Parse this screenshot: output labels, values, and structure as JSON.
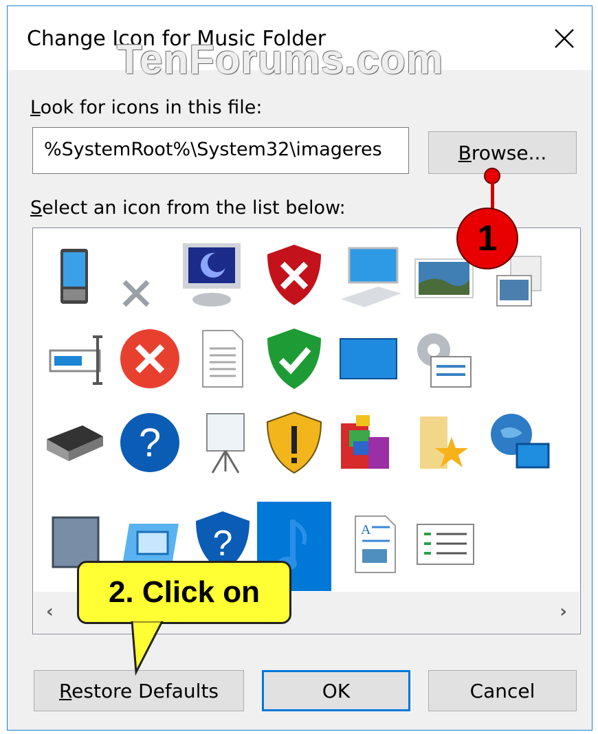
{
  "window": {
    "title": "Change Icon for Music Folder",
    "close_icon": "close-icon"
  },
  "watermark": "TenForums.com",
  "file_section": {
    "label_prefix": "L",
    "label_rest": "ook for icons in this file:",
    "path_value": "%SystemRoot%\\System32\\imageres",
    "browse_prefix": "B",
    "browse_rest": "rowse..."
  },
  "list_section": {
    "label_prefix": "S",
    "label_rest": "elect an icon from the list below:",
    "icons": [
      [
        "pda-icon",
        "x-mark-icon",
        "monitor-icon",
        "shield-error-icon",
        "computer-icon",
        "landscape-picture-icon",
        "pictures-stack-icon",
        "partial-icon"
      ],
      [
        "rename-field-icon",
        "error-circle-icon",
        "document-icon",
        "shield-check-icon",
        "display-icon",
        "gear-checklist-icon",
        "blank-icon",
        "folder-partial-icon"
      ],
      [
        "scanner-icon",
        "help-circle-icon",
        "projector-screen-icon",
        "shield-warning-icon",
        "programs-icon",
        "favorites-folder-icon",
        "network-globe-icon",
        "page-partial-icon"
      ],
      [
        "tablet-icon",
        "slideshow-icon",
        "shield-help-icon",
        "music-note-icon",
        "document-image-icon",
        "list-icon",
        "blank-icon",
        "certificate-icon"
      ]
    ],
    "selected_icon": "music-note-icon",
    "scroll_left": "‹",
    "scroll_right": "›"
  },
  "annotations": {
    "step1": "1",
    "step2": "2. Click on"
  },
  "buttons": {
    "restore_prefix": "R",
    "restore_rest": "estore Defaults",
    "ok": "OK",
    "cancel": "Cancel"
  },
  "colors": {
    "accent": "#0078d7",
    "callout": "#ffff33",
    "badge": "#e80000"
  }
}
